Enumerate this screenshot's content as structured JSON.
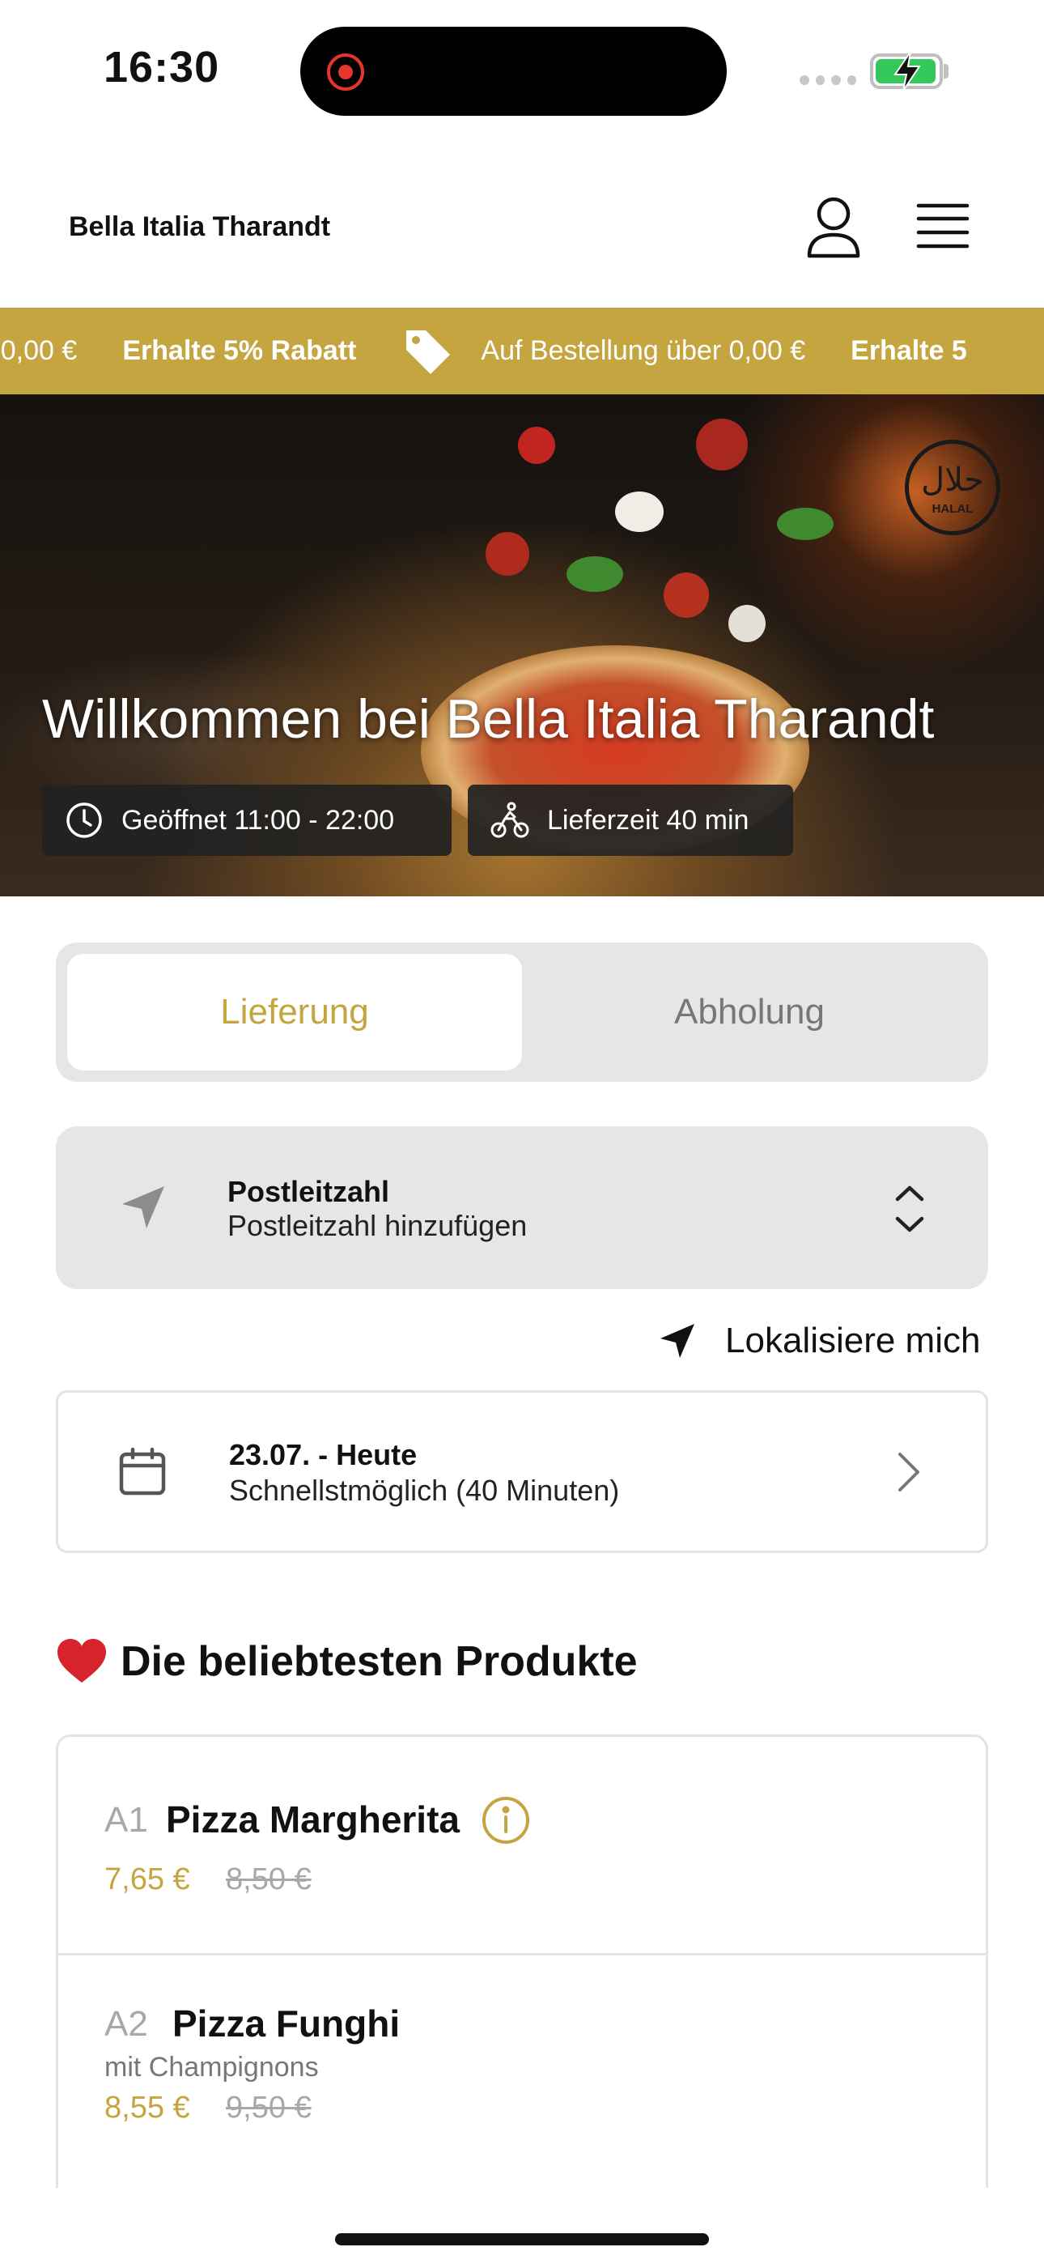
{
  "status_bar": {
    "time": "16:30"
  },
  "header": {
    "brand": "Bella Italia Tharandt"
  },
  "promo": {
    "items": [
      {
        "text": "r 0,00 €",
        "bold": false,
        "icon": null
      },
      {
        "text": "Erhalte 5% Rabatt",
        "bold": true,
        "icon": null
      },
      {
        "text": "Auf Bestellung über 0,00 €",
        "bold": false,
        "icon": "tag-icon"
      },
      {
        "text": "Erhalte 5",
        "bold": true,
        "icon": null
      }
    ],
    "color": "#c4a540"
  },
  "hero": {
    "title": "Willkommen bei Bella Italia Tharandt",
    "badge": "HALAL",
    "badge_arabic": "حلال",
    "hours": "Geöffnet 11:00 - 22:00",
    "delivery_time": "Lieferzeit 40 min"
  },
  "order_mode": {
    "delivery": "Lieferung",
    "pickup": "Abholung",
    "selected": "delivery"
  },
  "postcode": {
    "label": "Postleitzahl",
    "placeholder": "Postleitzahl hinzufügen"
  },
  "locate": {
    "label": "Lokalisiere mich"
  },
  "schedule": {
    "date": "23.07. - Heute",
    "time": "Schnellstmöglich (40 Minuten)"
  },
  "popular": {
    "title": "Die beliebtesten Produkte",
    "products": [
      {
        "code": "A1",
        "name": "Pizza Margherita",
        "description": "",
        "price": "7,65 €",
        "old_price": "8,50 €",
        "has_info": true
      },
      {
        "code": "A2",
        "name": "Pizza Funghi",
        "description": "mit Champignons",
        "price": "8,55 €",
        "old_price": "9,50 €",
        "has_info": false
      }
    ]
  },
  "colors": {
    "accent": "#c4a540",
    "muted": "#a8a8a8",
    "field_bg": "#e6e6e6"
  }
}
